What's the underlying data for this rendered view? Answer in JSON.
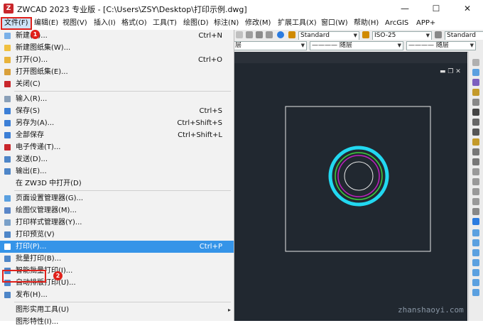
{
  "window": {
    "title": "ZWCAD 2023 专业版 - [C:\\Users\\ZSY\\Desktop\\打印示例.dwg]",
    "logo_text": "Z",
    "min": "—",
    "max": "☐",
    "close": "✕"
  },
  "menubar": {
    "items": [
      "文件(F)",
      "编辑(E)",
      "视图(V)",
      "插入(I)",
      "格式(O)",
      "工具(T)",
      "绘图(D)",
      "标注(N)",
      "修改(M)",
      "扩展工具(X)",
      "窗口(W)",
      "帮助(H)",
      "ArcGIS",
      "APP+"
    ]
  },
  "toolbar": {
    "text_style": "Standard",
    "dim_style": "ISO-25",
    "table_style": "Standard",
    "layer_suffix": "层",
    "linetype": "———— 随层",
    "lineweight": "———— 随层"
  },
  "filemenu": {
    "items": [
      {
        "label": "新建(N)...",
        "shortcut": "Ctrl+N"
      },
      {
        "label": "新建图纸集(W)...",
        "shortcut": ""
      },
      {
        "label": "打开(O)...",
        "shortcut": "Ctrl+O"
      },
      {
        "label": "打开图纸集(E)...",
        "shortcut": ""
      },
      {
        "label": "关闭(C)",
        "shortcut": ""
      },
      {
        "label": "输入(R)...",
        "shortcut": ""
      },
      {
        "label": "保存(S)",
        "shortcut": "Ctrl+S"
      },
      {
        "label": "另存为(A)...",
        "shortcut": "Ctrl+Shift+S"
      },
      {
        "label": "全部保存",
        "shortcut": "Ctrl+Shift+L"
      },
      {
        "label": "电子传递(T)...",
        "shortcut": ""
      },
      {
        "label": "发送(D)...",
        "shortcut": ""
      },
      {
        "label": "输出(E)...",
        "shortcut": ""
      },
      {
        "label": "在 ZW3D 中打开(D)",
        "shortcut": ""
      },
      {
        "label": "页面设置管理器(G)...",
        "shortcut": ""
      },
      {
        "label": "绘图仪管理器(M)...",
        "shortcut": ""
      },
      {
        "label": "打印样式管理器(Y)...",
        "shortcut": ""
      },
      {
        "label": "打印预览(V)",
        "shortcut": ""
      },
      {
        "label": "打印(P)...",
        "shortcut": "Ctrl+P"
      },
      {
        "label": "批量打印(B)...",
        "shortcut": ""
      },
      {
        "label": "智能批量打印(I)...",
        "shortcut": ""
      },
      {
        "label": "自动排版打印(U)...",
        "shortcut": ""
      },
      {
        "label": "发布(H)...",
        "shortcut": ""
      },
      {
        "label": "图形实用工具(U)",
        "shortcut": ""
      },
      {
        "label": "图形特性(I)...",
        "shortcut": ""
      }
    ],
    "highlighted": "打印(P)...",
    "submenu_arrow": "▸"
  },
  "annotations": {
    "badge1": "1",
    "badge2": "2"
  },
  "viewport": {
    "controls": "▬ ❐ ✕"
  },
  "watermark": "zhanshaoyi.com",
  "colors": {
    "highlight": "#3594e8",
    "canvas": "#212830",
    "annotation": "#e0211b",
    "circle_outer": "#22d8f0",
    "circle_green": "#3ed03e",
    "circle_magenta": "#c020c0"
  }
}
